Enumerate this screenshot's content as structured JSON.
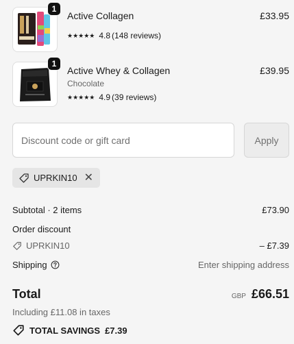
{
  "products": [
    {
      "name": "Active Collagen",
      "variant": "",
      "quantity": "1",
      "stars": "★★★★★",
      "rating": "4.8",
      "reviews": "(148 reviews)",
      "price": "£33.95"
    },
    {
      "name": "Active Whey & Collagen",
      "variant": "Chocolate",
      "quantity": "1",
      "stars": "★★★★★",
      "rating": "4.9",
      "reviews": "(39 reviews)",
      "price": "£39.95"
    }
  ],
  "discount": {
    "placeholder": "Discount code or gift card",
    "apply_label": "Apply",
    "applied_code": "UPRKIN10"
  },
  "summary": {
    "subtotal_label": "Subtotal · 2 items",
    "subtotal_value": "£73.90",
    "order_discount_label": "Order discount",
    "discount_code": "UPRKIN10",
    "discount_value": "– £7.39",
    "shipping_label": "Shipping",
    "shipping_value": "Enter shipping address",
    "total_label": "Total",
    "currency": "GBP",
    "total_value": "£66.51",
    "tax_note": "Including £11.08 in taxes",
    "savings_label": "TOTAL SAVINGS",
    "savings_value": "£7.39"
  },
  "colors": {
    "background": "#f5f5f5",
    "text": "#1a1a1a",
    "muted": "#666666",
    "chip": "#e5e5e5"
  }
}
